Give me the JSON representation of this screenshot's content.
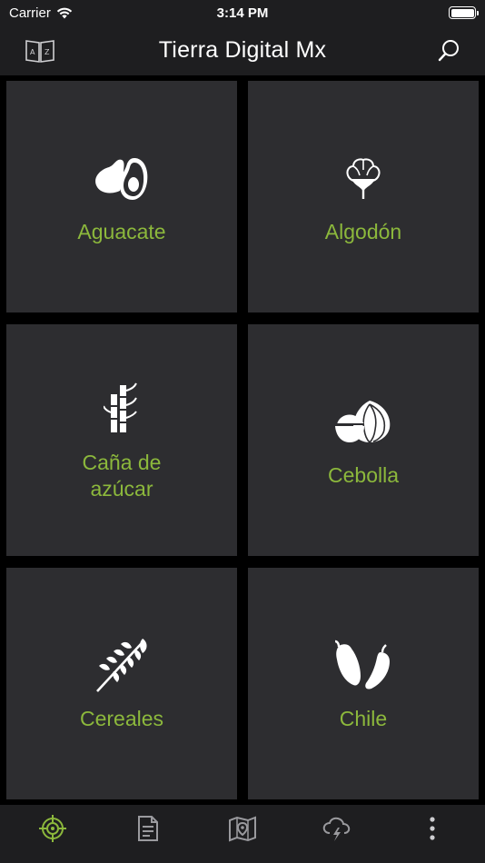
{
  "status_bar": {
    "carrier": "Carrier",
    "time": "3:14 PM"
  },
  "nav": {
    "title": "Tierra Digital Mx",
    "left_icon": "az-book-icon",
    "right_icon": "search-icon"
  },
  "crops": [
    {
      "label": "Aguacate",
      "icon": "avocado-icon"
    },
    {
      "label": "Algodón",
      "icon": "cotton-icon"
    },
    {
      "label": "Caña de azúcar",
      "icon": "sugarcane-icon"
    },
    {
      "label": "Cebolla",
      "icon": "onion-icon"
    },
    {
      "label": "Cereales",
      "icon": "wheat-icon"
    },
    {
      "label": "Chile",
      "icon": "chili-icon"
    }
  ],
  "tabs": [
    {
      "icon": "target-icon",
      "active": true
    },
    {
      "icon": "document-icon",
      "active": false
    },
    {
      "icon": "map-icon",
      "active": false
    },
    {
      "icon": "storm-cloud-icon",
      "active": false
    },
    {
      "icon": "more-icon",
      "active": false
    }
  ],
  "colors": {
    "accent": "#8cb83c",
    "tile": "#2d2d30",
    "bar": "#1e1e20",
    "inactive_icon": "#9a9a9e"
  }
}
